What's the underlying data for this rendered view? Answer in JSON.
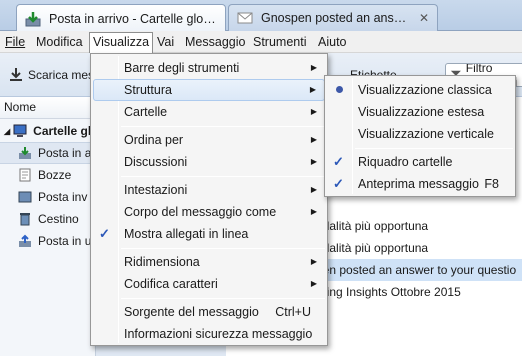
{
  "tabs": [
    {
      "label": "Posta in arrivo - Cartelle globali",
      "icon": "inbox-icon"
    },
    {
      "label": "Gnospen posted an answe…",
      "icon": "envelope-icon"
    }
  ],
  "tab_close": "✕",
  "menubar": [
    "File",
    "Modifica",
    "Visualizza",
    "Vai",
    "Messaggio",
    "Strumenti",
    "Aiuto"
  ],
  "toolbar": {
    "get_mail": "Scarica mes",
    "tag": "Etichette",
    "filter": "Filtro messaggi"
  },
  "leftpane": {
    "header": "Nome",
    "account": "Cartelle glo",
    "folders": [
      "Posta in a",
      "Bozze",
      "Posta inv",
      "Cestino",
      "Posta in u"
    ]
  },
  "messages": [
    "odalità più opportuna",
    "odalità più opportuna",
    "pen posted an answer to your questio",
    "rding Insights Ottobre 2015"
  ],
  "view_menu": {
    "items": [
      {
        "label": "Barre degli strumenti",
        "submenu": true
      },
      {
        "label": "Struttura",
        "submenu": true
      },
      {
        "label": "Cartelle",
        "submenu": true
      },
      {
        "label": "Ordina per",
        "submenu": true
      },
      {
        "label": "Discussioni",
        "submenu": true
      },
      {
        "label": "Intestazioni",
        "submenu": true
      },
      {
        "label": "Corpo del messaggio come",
        "submenu": true
      },
      {
        "label": "Mostra allegati in linea",
        "checked": true
      },
      {
        "label": "Ridimensiona",
        "submenu": true
      },
      {
        "label": "Codifica caratteri",
        "submenu": true
      },
      {
        "label": "Sorgente del messaggio",
        "shortcut": "Ctrl+U"
      },
      {
        "label": "Informazioni sicurezza messaggio"
      }
    ]
  },
  "layout_submenu": {
    "items": [
      {
        "label": "Visualizzazione classica",
        "radio_selected": true
      },
      {
        "label": "Visualizzazione estesa"
      },
      {
        "label": "Visualizzazione verticale"
      },
      {
        "label": "Riquadro cartelle",
        "checked": true
      },
      {
        "label": "Anteprima messaggio",
        "checked": true,
        "shortcut": "F8"
      }
    ]
  },
  "check_glyph": "✓",
  "arrow_glyph": "▶",
  "colors": {
    "accent": "#2c58b8",
    "menu_bg": "#f5f5f5",
    "highlight": "#cfe2f7"
  }
}
